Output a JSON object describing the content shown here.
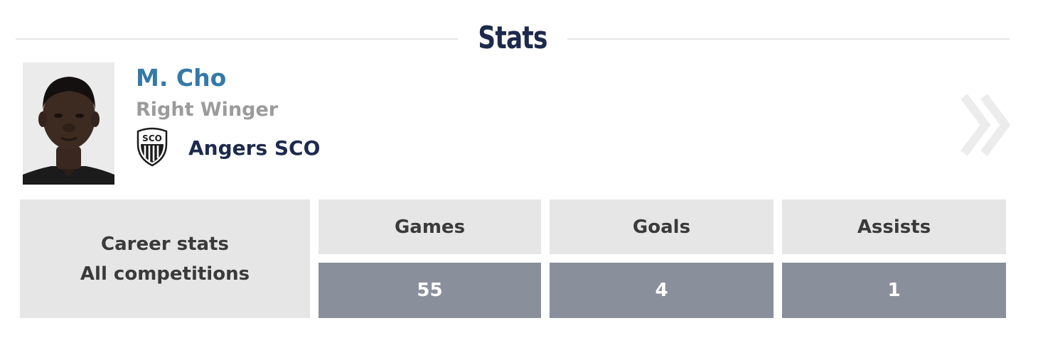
{
  "header": {
    "title": "Stats"
  },
  "player": {
    "name": "M. Cho",
    "position": "Right Winger",
    "club": "Angers SCO",
    "club_logo_text": "SCO"
  },
  "career": {
    "line1": "Career stats",
    "line2": "All competitions"
  },
  "stats": {
    "columns": [
      {
        "label": "Games",
        "value": "55"
      },
      {
        "label": "Goals",
        "value": "4"
      },
      {
        "label": "Assists",
        "value": "1"
      }
    ]
  },
  "colors": {
    "title": "#1e2a4c",
    "name": "#3479a8",
    "position": "#9b9b9b",
    "cell_light": "#e6e6e6",
    "cell_dark": "#8a8f9c"
  },
  "icons": {
    "next": "double-chevron-right-icon",
    "club": "club-crest-icon"
  }
}
